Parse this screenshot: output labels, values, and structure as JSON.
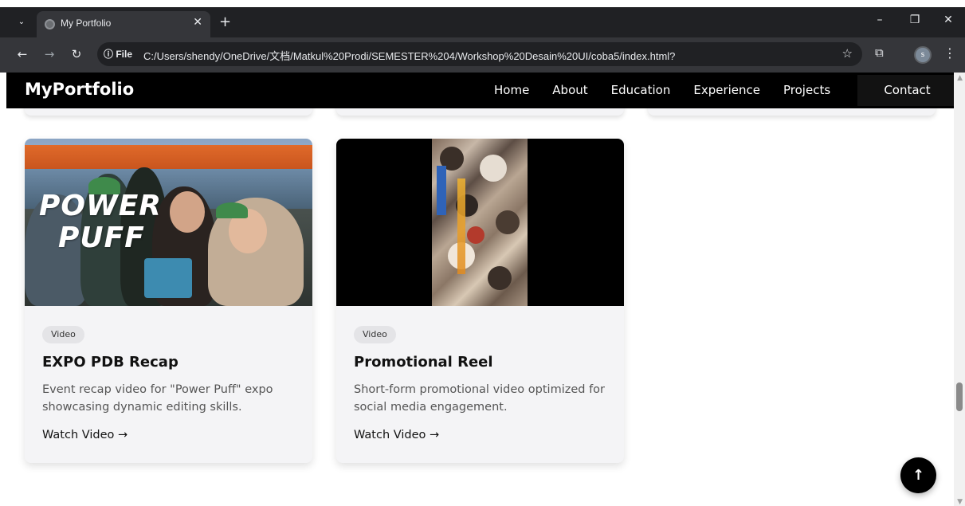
{
  "browser": {
    "tab_title": "My Portfolio",
    "tab_close": "✕",
    "new_tab": "+",
    "info_chip": "ⓘ File",
    "url": "C:/Users/shendy/OneDrive/文档/Matkul%20Prodi/SEMESTER%204/Workshop%20Desain%20UI/coba5/index.html?",
    "profile_initial": "s"
  },
  "site": {
    "logo": "MyPortfolio",
    "nav": [
      {
        "label": "Home"
      },
      {
        "label": "About"
      },
      {
        "label": "Education"
      },
      {
        "label": "Experience"
      },
      {
        "label": "Projects"
      }
    ],
    "contact_label": "Contact"
  },
  "projects": [
    {
      "badge": "Video",
      "title": "EXPO PDB Recap",
      "description": "Event recap video for \"Power Puff\" expo showcasing dynamic editing skills.",
      "link": "Watch Video →",
      "thumb_text_1": "POWER",
      "thumb_text_2": "PUFF"
    },
    {
      "badge": "Video",
      "title": "Promotional Reel",
      "description": "Short-form promotional video optimized for social media engagement.",
      "link": "Watch Video →"
    }
  ],
  "back_to_top": "↑"
}
